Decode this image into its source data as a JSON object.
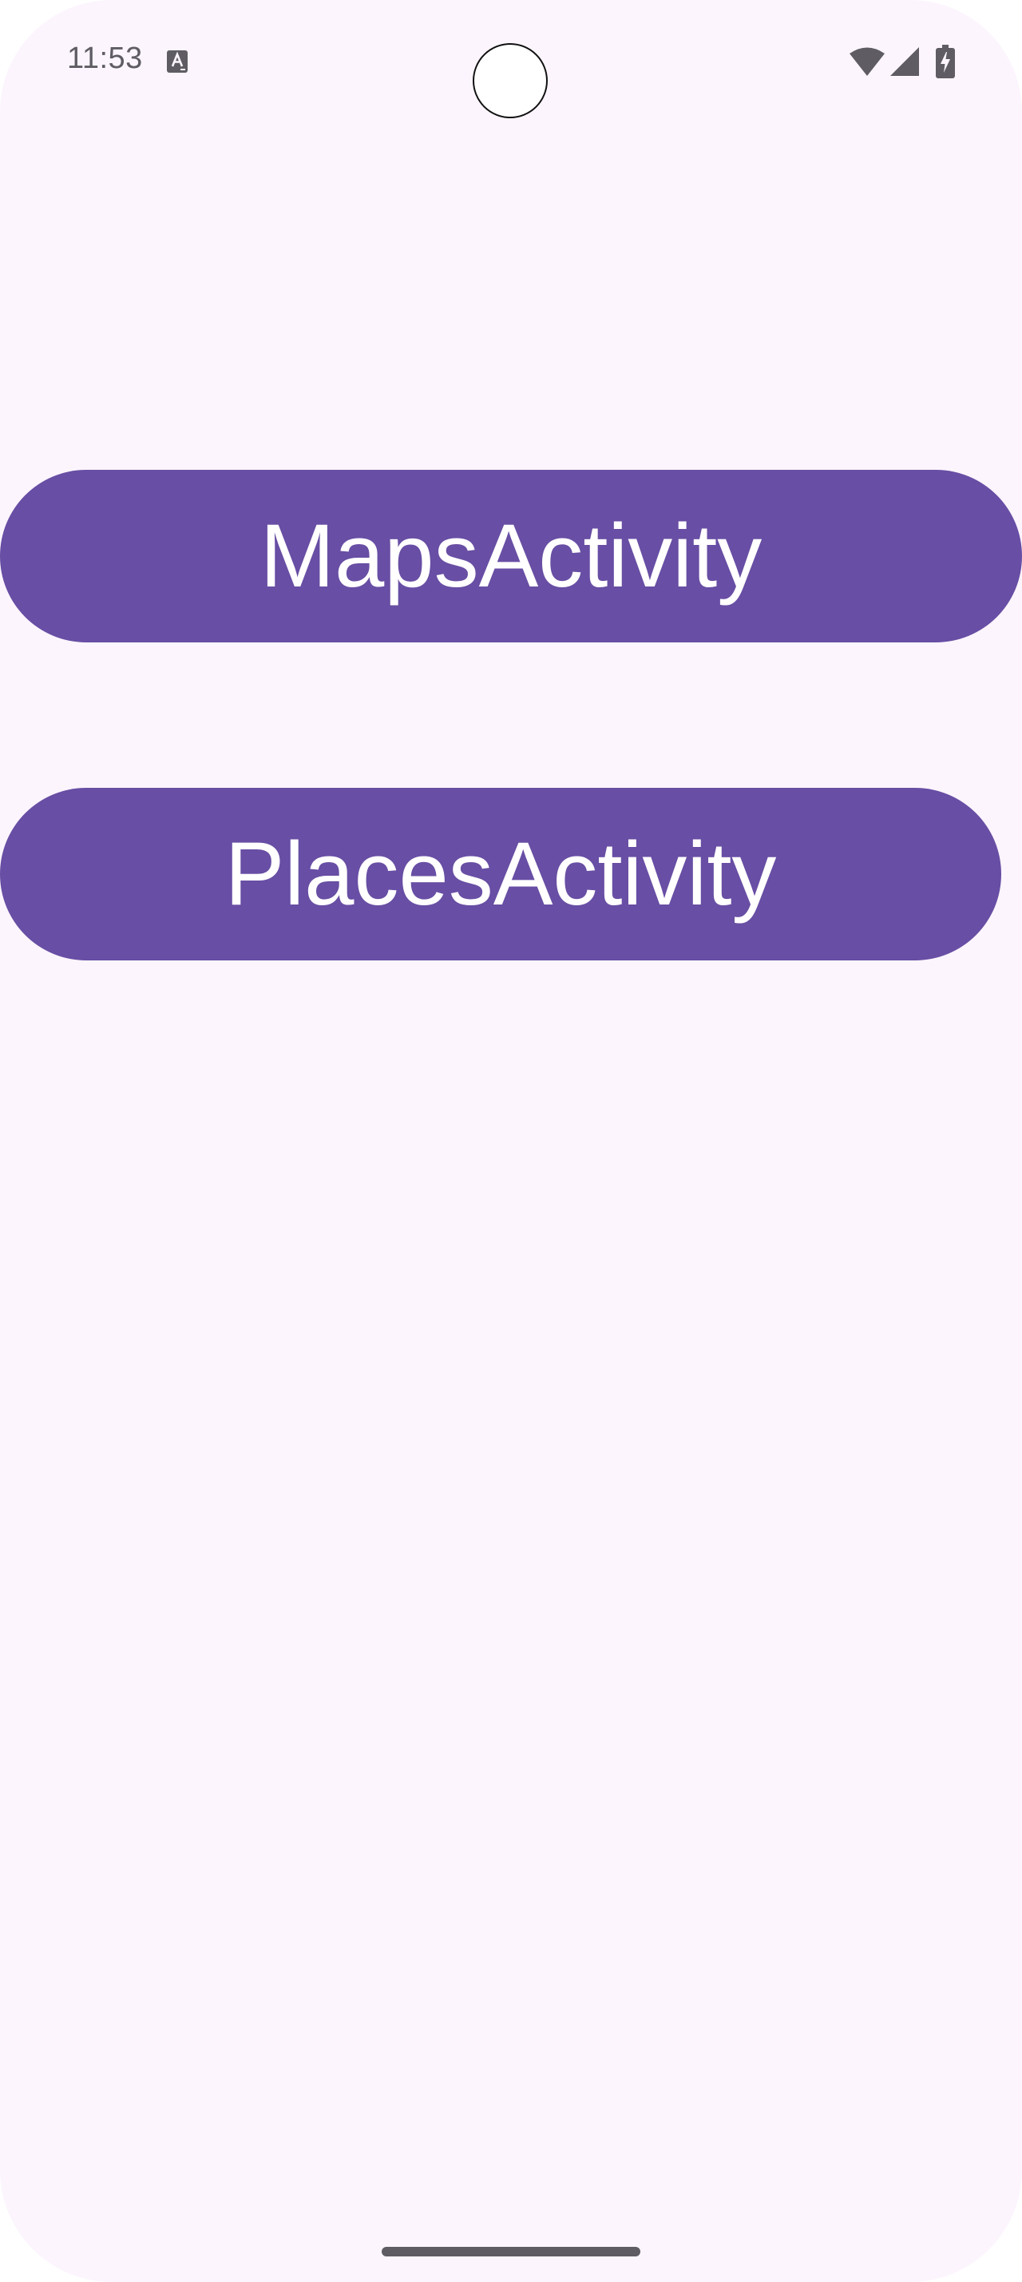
{
  "status_bar": {
    "time": "11:53",
    "icons": [
      "keyboard-a-icon",
      "wifi-icon",
      "cellular-signal-icon",
      "battery-charging-icon"
    ]
  },
  "main": {
    "buttons": [
      {
        "label": "MapsActivity"
      },
      {
        "label": "PlacesActivity"
      }
    ]
  },
  "colors": {
    "background": "#fcf5fd",
    "button": "#684ea4",
    "button_text": "#ffffff",
    "status_icons": "#5f5d63"
  }
}
